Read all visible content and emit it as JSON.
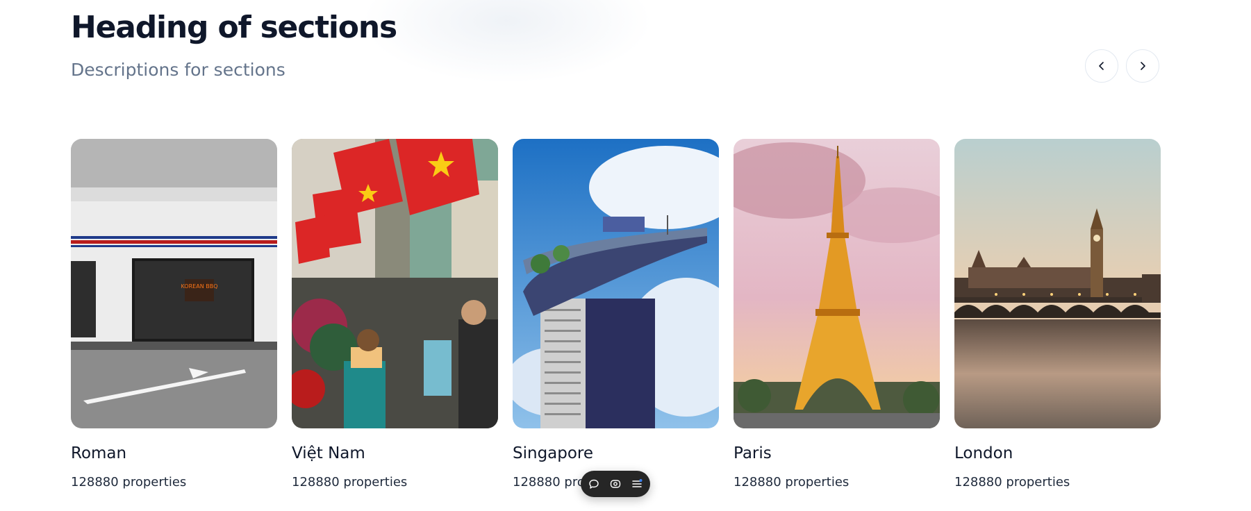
{
  "section": {
    "title": "Heading of sections",
    "description": "Descriptions for sections"
  },
  "navigation": {
    "prev_icon": "chevron-left-icon",
    "next_icon": "chevron-right-icon"
  },
  "destinations": [
    {
      "name": "Roman",
      "properties": "128880 properties",
      "sign_text": "KOREAN BBQ"
    },
    {
      "name": "Việt Nam",
      "properties": "128880 properties"
    },
    {
      "name": "Singapore",
      "properties": "128880 properties"
    },
    {
      "name": "Paris",
      "properties": "128880 properties"
    },
    {
      "name": "London",
      "properties": "128880 properties"
    }
  ],
  "toolbar": {
    "items": [
      "comment-icon",
      "eye-icon",
      "menu-icon"
    ]
  },
  "colors": {
    "heading": "#0f172a",
    "description": "#64748b",
    "toolbar_bg": "#262626"
  }
}
